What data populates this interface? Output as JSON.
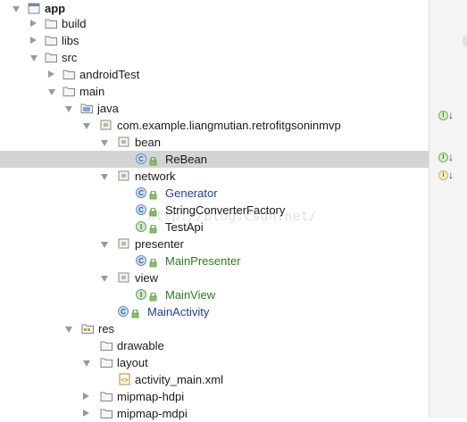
{
  "project_tree": {
    "nodes": [
      {
        "label": "app",
        "icon": "module-icon",
        "arrow": "down",
        "bold": true
      },
      {
        "label": "build",
        "icon": "folder-icon",
        "arrow": "right"
      },
      {
        "label": "libs",
        "icon": "folder-icon",
        "arrow": "right"
      },
      {
        "label": "src",
        "icon": "folder-icon",
        "arrow": "down"
      },
      {
        "label": "androidTest",
        "icon": "folder-icon",
        "arrow": "right"
      },
      {
        "label": "main",
        "icon": "folder-icon",
        "arrow": "down"
      },
      {
        "label": "java",
        "icon": "source-folder-icon",
        "arrow": "down"
      },
      {
        "label": "com.example.liangmutian.retrofitgsoninmvp",
        "icon": "package-icon",
        "arrow": "down"
      },
      {
        "label": "bean",
        "icon": "package-icon",
        "arrow": "down"
      },
      {
        "label": "ReBean",
        "icon": "class-icon",
        "selected": true
      },
      {
        "label": "network",
        "icon": "package-icon",
        "arrow": "down"
      },
      {
        "label": "Generator",
        "icon": "class-icon",
        "color": "blue"
      },
      {
        "label": "StringConverterFactory",
        "icon": "class-icon"
      },
      {
        "label": "TestApi",
        "icon": "interface-icon"
      },
      {
        "label": "presenter",
        "icon": "package-icon",
        "arrow": "down"
      },
      {
        "label": "MainPresenter",
        "icon": "class-icon",
        "color": "green"
      },
      {
        "label": "view",
        "icon": "package-icon",
        "arrow": "down"
      },
      {
        "label": "MainView",
        "icon": "interface-icon",
        "color": "green"
      },
      {
        "label": "MainActivity",
        "icon": "class-icon",
        "color": "blue"
      },
      {
        "label": "res",
        "icon": "resource-folder-icon",
        "arrow": "down"
      },
      {
        "label": "drawable",
        "icon": "folder-icon"
      },
      {
        "label": "layout",
        "icon": "folder-icon",
        "arrow": "down"
      },
      {
        "label": "activity_main.xml",
        "icon": "xml-file-icon"
      },
      {
        "label": "mipmap-hdpi",
        "icon": "folder-icon",
        "arrow": "right"
      },
      {
        "label": "mipmap-mdpi",
        "icon": "folder-icon",
        "arrow": "right"
      }
    ]
  },
  "watermark": "http://blog.csdn.net/",
  "gutter": {
    "markers": [
      {
        "icon": "implemented-interface-icon",
        "glyph": "I",
        "arrow": "↓"
      },
      {
        "icon": "implemented-interface-icon",
        "glyph": "I",
        "arrow": "↓"
      },
      {
        "icon": "implemented-interface-icon",
        "glyph": "I",
        "arrow": "↓",
        "tinted": true
      }
    ]
  },
  "colors": {
    "selection": "#d4d4d4",
    "class_blue": "#1c3fa8",
    "interface_green": "#2c7a1e",
    "folder": "#8a93a0"
  }
}
